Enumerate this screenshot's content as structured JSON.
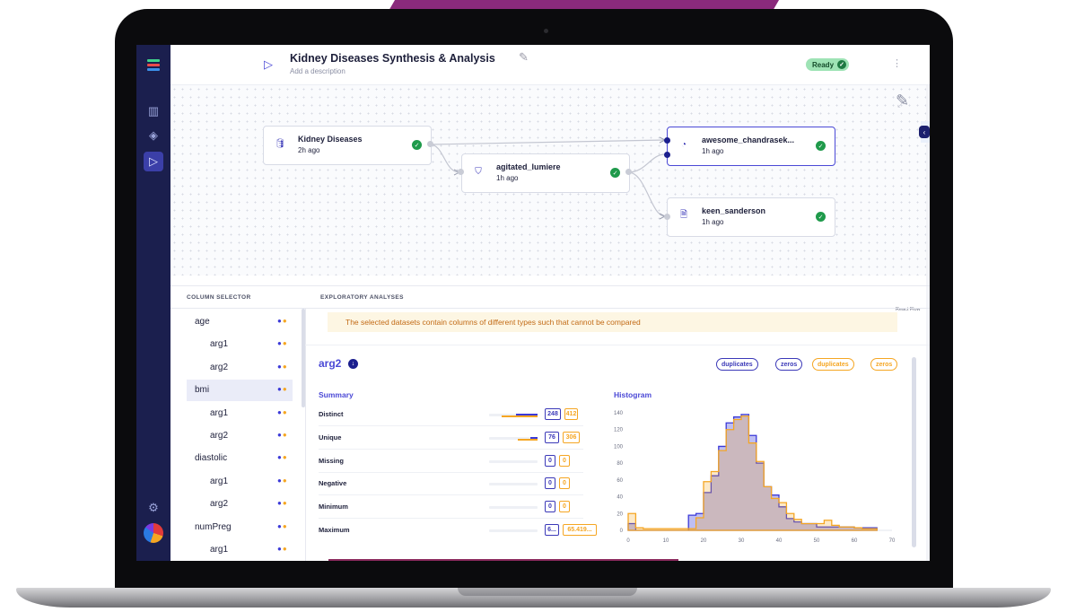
{
  "header": {
    "title": "Kidney Diseases Synthesis & Analysis",
    "description_placeholder": "Add a description",
    "status": "Ready"
  },
  "flow": {
    "nodes": [
      {
        "title": "Kidney Diseases",
        "time": "2h ago",
        "icon": "database-icon"
      },
      {
        "title": "agitated_lumiere",
        "time": "1h ago",
        "icon": "shield-icon"
      },
      {
        "title": "awesome_chandrasek...",
        "time": "1h ago",
        "icon": "chart-pie-icon"
      },
      {
        "title": "keen_sanderson",
        "time": "1h ago",
        "icon": "document-icon"
      }
    ],
    "attribution": "React Flow"
  },
  "panels": {
    "column_selector": "COLUMN SELECTOR",
    "exploratory": "EXPLORATORY ANALYSES"
  },
  "columns": [
    {
      "label": "age",
      "indent": 0
    },
    {
      "label": "arg1",
      "indent": 1
    },
    {
      "label": "arg2",
      "indent": 1
    },
    {
      "label": "bmi",
      "indent": 0,
      "selected": true
    },
    {
      "label": "arg1",
      "indent": 1
    },
    {
      "label": "arg2",
      "indent": 1
    },
    {
      "label": "diastolic",
      "indent": 0
    },
    {
      "label": "arg1",
      "indent": 1
    },
    {
      "label": "arg2",
      "indent": 1
    },
    {
      "label": "numPreg",
      "indent": 0
    },
    {
      "label": "arg1",
      "indent": 1
    }
  ],
  "analysis": {
    "warning": "The selected datasets contain columns of different types such that cannot be compared",
    "variable": "arg2",
    "chips_blue": [
      "duplicates",
      "zeros"
    ],
    "chips_orange": [
      "duplicates",
      "zeros"
    ],
    "summary_title": "Summary",
    "histogram_title": "Histogram",
    "stats": [
      {
        "label": "Distinct",
        "blue": "248",
        "orange": "412",
        "blue_frac": 0.45,
        "orange_frac": 0.75
      },
      {
        "label": "Unique",
        "blue": "76",
        "orange": "306",
        "blue_frac": 0.14,
        "orange_frac": 0.4
      },
      {
        "label": "Missing",
        "blue": "0",
        "orange": "0",
        "blue_frac": 0,
        "orange_frac": 0
      },
      {
        "label": "Negative",
        "blue": "0",
        "orange": "0",
        "blue_frac": 0,
        "orange_frac": 0
      },
      {
        "label": "Minimum",
        "blue": "0",
        "orange": "0",
        "blue_frac": 0,
        "orange_frac": 0
      },
      {
        "label": "Maximum",
        "blue": "6...",
        "orange": "65.419...",
        "blue_frac": 0,
        "orange_frac": 0
      }
    ]
  },
  "chart_data": {
    "type": "area",
    "title": "Histogram",
    "xlim": [
      0,
      70
    ],
    "ylim": [
      0,
      140
    ],
    "x_ticks": [
      0,
      10,
      20,
      30,
      40,
      50,
      60,
      70
    ],
    "y_ticks": [
      0,
      20,
      40,
      60,
      80,
      100,
      120,
      140
    ],
    "bin_edges": [
      0,
      2,
      4,
      6,
      8,
      10,
      12,
      14,
      16,
      18,
      20,
      22,
      24,
      26,
      28,
      30,
      32,
      34,
      36,
      38,
      40,
      42,
      44,
      46,
      48,
      50,
      52,
      54,
      56,
      58,
      60,
      62,
      64,
      66
    ],
    "series": [
      {
        "name": "arg2",
        "color": "#3b39d8",
        "values": [
          8,
          0,
          0,
          0,
          0,
          0,
          0,
          0,
          18,
          20,
          45,
          65,
          100,
          128,
          135,
          138,
          113,
          80,
          52,
          42,
          28,
          14,
          10,
          8,
          8,
          4,
          4,
          4,
          4,
          4,
          3,
          3,
          3
        ]
      },
      {
        "name": "arg2",
        "color": "#f5a623",
        "values": [
          20,
          3,
          2,
          2,
          2,
          2,
          2,
          2,
          2,
          15,
          58,
          70,
          95,
          120,
          132,
          136,
          104,
          82,
          52,
          38,
          33,
          20,
          13,
          8,
          8,
          8,
          12,
          6,
          4,
          4,
          3,
          2,
          2
        ]
      }
    ]
  }
}
